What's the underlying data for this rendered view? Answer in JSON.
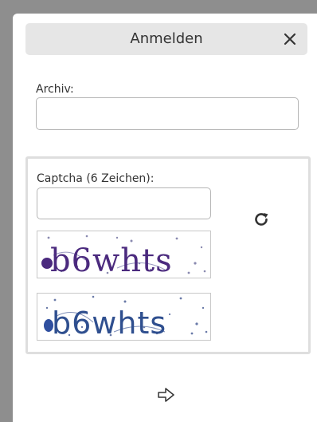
{
  "dialog": {
    "title": "Anmelden",
    "close_icon": "close-icon"
  },
  "archive": {
    "label": "Archiv:",
    "value": "",
    "placeholder": ""
  },
  "captcha": {
    "label": "Captcha (6 Zeichen):",
    "value": "",
    "placeholder": "",
    "refresh_icon": "refresh-icon",
    "image_text": "b6whts"
  },
  "submit": {
    "icon": "arrow-right-icon"
  },
  "colors": {
    "titlebar_bg": "#e6e6e6",
    "captcha_purple": "#4b2a7e",
    "captcha_blue": "#2f4f8f",
    "border": "#b5b5b5"
  }
}
